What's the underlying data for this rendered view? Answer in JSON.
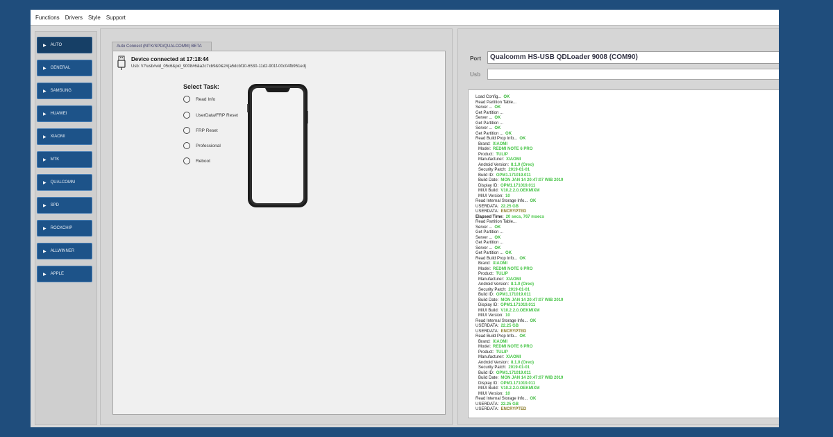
{
  "menu": [
    "Functions",
    "Drivers",
    "Style",
    "Support"
  ],
  "sidebar": {
    "items": [
      "AUTO",
      "GENERAL",
      "SAMSUNG",
      "HUAWEI",
      "XIAOMI",
      "MTK",
      "QUALCOMM",
      "SPD",
      "ROCKCHIP",
      "ALLWINNER",
      "APPLE"
    ],
    "active": "AUTO"
  },
  "tab": {
    "label": "Auto Connect (MTK/SPD/QUALCOMM) BETA"
  },
  "device": {
    "title": "Device connected at 17:18:44",
    "usb": "Usb: \\\\?\\usb#vid_05c6&pid_9008#6&a2c7cb9&0&2#{a5dcbf10-6530-11d2-901f-00c04fb951ed}"
  },
  "tasks": {
    "title": "Select Task:",
    "options": [
      "Read Info",
      "UserData/FRP Reset",
      "FRP Reset",
      "Professional",
      "Reboot"
    ]
  },
  "port": {
    "label": "Port",
    "value": "Qualcomm HS-USB QDLoader 9008 (COM90)"
  },
  "usb_field": {
    "label": "Usb",
    "value": ""
  },
  "colors": {
    "ok": "#3cb83c",
    "value": "#45c445",
    "encrypted": "#8a7a26",
    "elapsed": "#45c445"
  },
  "log": [
    {
      "label": "Load Config...",
      "value": "OK"
    },
    {
      "label": "Read Partition Table...",
      "value": ""
    },
    {
      "label": "Server ...",
      "value": "OK"
    },
    {
      "label": "Get Partition ...",
      "value": ""
    },
    {
      "label": "Server ...",
      "value": "OK"
    },
    {
      "label": "Get Partition ...",
      "value": ""
    },
    {
      "label": "Server ...",
      "value": "OK"
    },
    {
      "label": "Get Partition ...",
      "value": "OK"
    },
    {
      "label": "Read Build Prop Info...",
      "value": "OK"
    },
    {
      "label": "Brand:",
      "value": "XIAOMI",
      "indent": true
    },
    {
      "label": "Model:",
      "value": "REDMI NOTE 6 PRO",
      "indent": true
    },
    {
      "label": "Product:",
      "value": "TULIP",
      "indent": true
    },
    {
      "label": "Manufacturer:",
      "value": "XIAOMI",
      "indent": true
    },
    {
      "label": "Android Version:",
      "value": "8.1.0 (Oreo)",
      "indent": true
    },
    {
      "label": "Security Patch:",
      "value": "2019-01-01",
      "indent": true
    },
    {
      "label": "Build ID:",
      "value": "OPM1.171019.011",
      "indent": true
    },
    {
      "label": "Build Date:",
      "value": "MON JAN 14 20:47:07 WIB 2019",
      "indent": true
    },
    {
      "label": "Display ID:",
      "value": "OPM1.171019.011",
      "indent": true
    },
    {
      "label": "MIUI Build:",
      "value": "V10.2.2.0.OEKMIXM",
      "indent": true
    },
    {
      "label": "MIUI Version:",
      "value": "10",
      "indent": true
    },
    {
      "label": "Read Internal Storage Info...",
      "value": "OK"
    },
    {
      "label": "USERDATA:",
      "value": "22.25 GB"
    },
    {
      "label": "USERDATA:",
      "value": "ENCRYPTED",
      "kind": "encrypted"
    },
    {
      "label": "Elapsed Time:",
      "value": "20 secs, 767 msecs",
      "bold": true
    },
    {
      "label": "Read Partition Table...",
      "value": ""
    },
    {
      "label": "Server ...",
      "value": "OK"
    },
    {
      "label": "Get Partition ...",
      "value": ""
    },
    {
      "label": "Server ...",
      "value": "OK"
    },
    {
      "label": "Get Partition ...",
      "value": ""
    },
    {
      "label": "Server ...",
      "value": "OK"
    },
    {
      "label": "Get Partition ...",
      "value": "OK"
    },
    {
      "label": "Read Build Prop Info...",
      "value": "OK"
    },
    {
      "label": "Brand:",
      "value": "XIAOMI",
      "indent": true
    },
    {
      "label": "Model:",
      "value": "REDMI NOTE 6 PRO",
      "indent": true
    },
    {
      "label": "Product:",
      "value": "TULIP",
      "indent": true
    },
    {
      "label": "Manufacturer:",
      "value": "XIAOMI",
      "indent": true
    },
    {
      "label": "Android Version:",
      "value": "8.1.0 (Oreo)",
      "indent": true
    },
    {
      "label": "Security Patch:",
      "value": "2019-01-01",
      "indent": true
    },
    {
      "label": "Build ID:",
      "value": "OPM1.171019.011",
      "indent": true
    },
    {
      "label": "Build Date:",
      "value": "MON JAN 14 20:47:07 WIB 2019",
      "indent": true
    },
    {
      "label": "Display ID:",
      "value": "OPM1.171019.011",
      "indent": true
    },
    {
      "label": "MIUI Build:",
      "value": "V10.2.2.0.OEKMIXM",
      "indent": true
    },
    {
      "label": "MIUI Version:",
      "value": "10",
      "indent": true
    },
    {
      "label": "Read Internal Storage Info...",
      "value": "OK"
    },
    {
      "label": "USERDATA:",
      "value": "22.25 GB"
    },
    {
      "label": "USERDATA:",
      "value": "ENCRYPTED",
      "kind": "encrypted"
    },
    {
      "label": "Read Build Prop Info...",
      "value": "OK"
    },
    {
      "label": "Brand:",
      "value": "XIAOMI",
      "indent": true
    },
    {
      "label": "Model:",
      "value": "REDMI NOTE 6 PRO",
      "indent": true
    },
    {
      "label": "Product:",
      "value": "TULIP",
      "indent": true
    },
    {
      "label": "Manufacturer:",
      "value": "XIAOMI",
      "indent": true
    },
    {
      "label": "Android Version:",
      "value": "8.1.0 (Oreo)",
      "indent": true
    },
    {
      "label": "Security Patch:",
      "value": "2019-01-01",
      "indent": true
    },
    {
      "label": "Build ID:",
      "value": "OPM1.171019.011",
      "indent": true
    },
    {
      "label": "Build Date:",
      "value": "MON JAN 14 20:47:07 WIB 2019",
      "indent": true
    },
    {
      "label": "Display ID:",
      "value": "OPM1.171019.011",
      "indent": true
    },
    {
      "label": "MIUI Build:",
      "value": "V10.2.2.0.OEKMIXM",
      "indent": true
    },
    {
      "label": "MIUI Version:",
      "value": "10",
      "indent": true
    },
    {
      "label": "Read Internal Storage Info...",
      "value": "OK"
    },
    {
      "label": "USERDATA:",
      "value": "22.25 GB"
    },
    {
      "label": "USERDATA:",
      "value": "ENCRYPTED",
      "kind": "encrypted"
    }
  ]
}
